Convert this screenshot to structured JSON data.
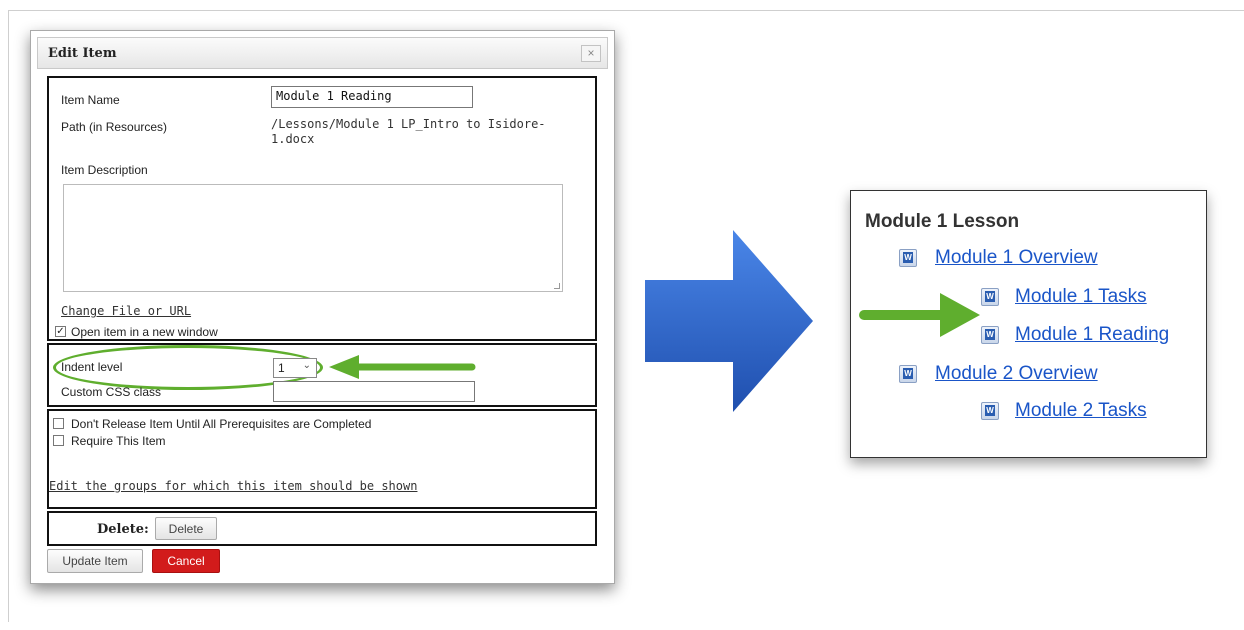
{
  "dialog": {
    "title": "Edit Item",
    "close_glyph": "×",
    "fields": {
      "item_name_label": "Item Name",
      "item_name_value": "Module 1 Reading",
      "path_label": "Path (in Resources)",
      "path_value_line1": "/Lessons/Module 1 LP_Intro to Isidore-",
      "path_value_line2": "1.docx",
      "description_label": "Item Description",
      "change_file_link": "Change File or URL",
      "open_new_window_label": "Open item in a new window",
      "open_new_window_checked": true,
      "indent_label": "Indent level",
      "indent_value": "1",
      "css_label": "Custom CSS class",
      "css_value": "",
      "prereq_label": "Don't Release Item Until All Prerequisites are Completed",
      "require_label": "Require This Item",
      "groups_link": "Edit the groups for which this item should be shown",
      "delete_label": "Delete:",
      "delete_button": "Delete"
    },
    "buttons": {
      "update": "Update Item",
      "cancel": "Cancel"
    }
  },
  "lesson": {
    "title": "Module 1 Lesson",
    "items": [
      {
        "label": "Module 1 Overview",
        "indent": 0
      },
      {
        "label": "Module 1 Tasks",
        "indent": 1
      },
      {
        "label": "Module 1 Reading",
        "indent": 1
      },
      {
        "label": "Module 2 Overview",
        "indent": 0
      },
      {
        "label": "Module 2 Tasks",
        "indent": 1
      }
    ]
  },
  "colors": {
    "highlight_green": "#5fae2e",
    "big_arrow_blue": "#2e62c7",
    "link_blue": "#1a55c8",
    "cancel_red": "#d21b1b"
  }
}
